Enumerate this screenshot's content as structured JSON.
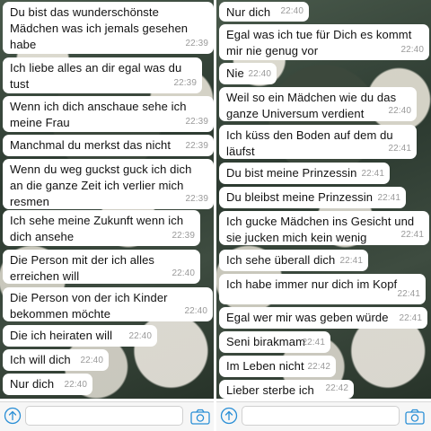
{
  "left": {
    "messages": [
      {
        "text": "Du bist das wunderschönste\nMädchen was ich jemals gesehen\nhabe",
        "time": "22:39"
      },
      {
        "text": "Ich liebe alles an dir egal was du\ntust",
        "time": "22:39"
      },
      {
        "text": "Wenn ich dich anschaue sehe ich\nmeine Frau",
        "time": "22:39"
      },
      {
        "text": "Manchmal du merkst das nicht",
        "time": "22:39"
      },
      {
        "text": "Wenn du weg guckst guck ich dich\nan die ganze Zeit ich verlier mich\nresmen",
        "time": "22:39"
      },
      {
        "text": "Ich sehe meine Zukunft wenn ich\ndich ansehe",
        "time": "22:39"
      },
      {
        "text": "Die Person mit der ich alles\nerreichen will",
        "time": "22:40"
      },
      {
        "text": "Die Person von der ich Kinder\nbekommen möchte",
        "time": "22:40"
      },
      {
        "text": "Die ich heiraten will",
        "time": "22:40"
      },
      {
        "text": "Ich will dich",
        "time": "22:40"
      },
      {
        "text": "Nur dich",
        "time": "22:40"
      }
    ]
  },
  "right": {
    "messages": [
      {
        "text": "Nur dich",
        "time": "22:40"
      },
      {
        "text": "Egal was ich tue für Dich es kommt\nmir nie genug vor",
        "time": "22:40"
      },
      {
        "text": "Nie",
        "time": "22:40"
      },
      {
        "text": "Weil so ein Mädchen wie du das\nganze Universum verdient",
        "time": "22:40"
      },
      {
        "text": "Ich küss den Boden auf dem du\nläufst",
        "time": "22:41"
      },
      {
        "text": "Du bist meine Prinzessin",
        "time": "22:41"
      },
      {
        "text": "Du bleibst meine Prinzessin",
        "time": "22:41"
      },
      {
        "text": "Ich gucke Mädchen ins Gesicht und\nsie jucken mich kein wenig",
        "time": "22:41"
      },
      {
        "text": "Ich sehe überall dich",
        "time": "22:41"
      },
      {
        "text": "Ich habe immer nur dich im Kopf",
        "time": "22:41"
      },
      {
        "text": "Egal wer mir was geben würde",
        "time": "22:41"
      },
      {
        "text": "Seni birakmam",
        "time": "22:41"
      },
      {
        "text": "Im Leben nicht",
        "time": "22:42"
      },
      {
        "text": "Lieber sterbe ich",
        "time": "22:42"
      }
    ]
  },
  "icons": {
    "upload": "upload-arrow-icon",
    "camera": "camera-icon"
  },
  "colors": {
    "bubble": "#ffffff",
    "timestamp": "#9a9a9a",
    "icon_blue": "#2a8fd6"
  }
}
